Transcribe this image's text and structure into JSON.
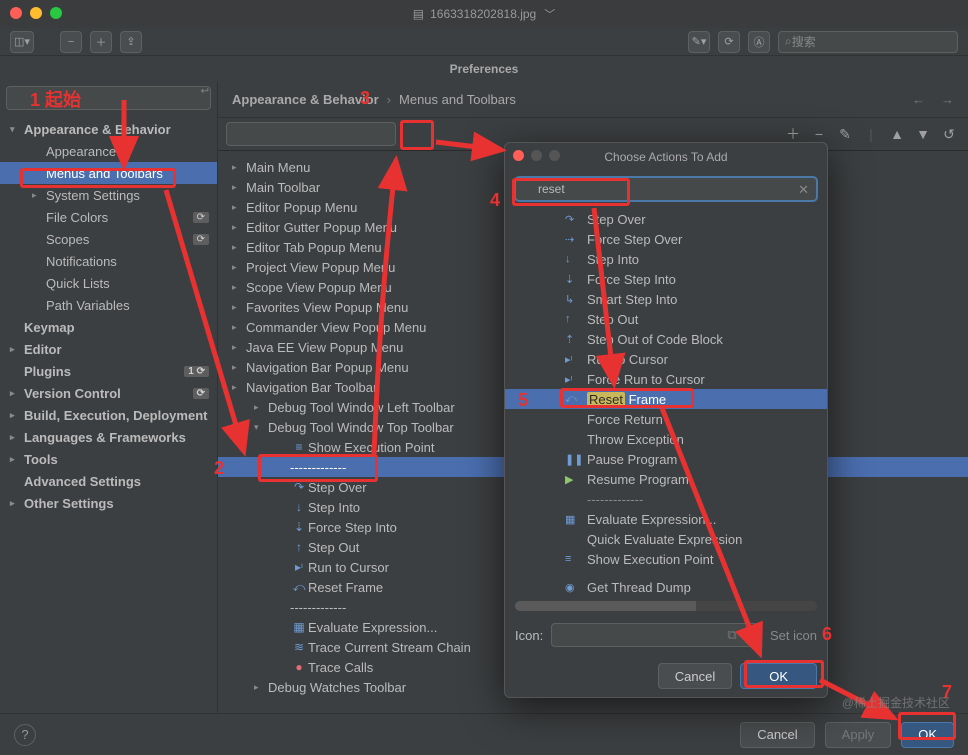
{
  "titlebar": {
    "filename": "1663318202818.jpg"
  },
  "maintool": {
    "search": "搜索"
  },
  "prefs_title": "Preferences",
  "breadcrumb": {
    "a": "Appearance & Behavior",
    "b": "Menus and Toolbars"
  },
  "sidebar": {
    "items": [
      {
        "label": "Appearance & Behavior",
        "caret": "▾",
        "bold": true,
        "lvl": 0
      },
      {
        "label": "Appearance",
        "lvl": 1
      },
      {
        "label": "Menus and Toolbars",
        "lvl": 1,
        "sel": true
      },
      {
        "label": "System Settings",
        "lvl": 1,
        "caret": "▸"
      },
      {
        "label": "File Colors",
        "lvl": 1,
        "badge": "⟳"
      },
      {
        "label": "Scopes",
        "lvl": 1,
        "badge": "⟳"
      },
      {
        "label": "Notifications",
        "lvl": 1
      },
      {
        "label": "Quick Lists",
        "lvl": 1
      },
      {
        "label": "Path Variables",
        "lvl": 1
      },
      {
        "label": "Keymap",
        "caret": "",
        "bold": true,
        "lvl": 0
      },
      {
        "label": "Editor",
        "caret": "▸",
        "bold": true,
        "lvl": 0
      },
      {
        "label": "Plugins",
        "caret": "",
        "bold": true,
        "lvl": 0,
        "badge": "1 ⟳"
      },
      {
        "label": "Version Control",
        "caret": "▸",
        "bold": true,
        "lvl": 0,
        "badge": "⟳"
      },
      {
        "label": "Build, Execution, Deployment",
        "caret": "▸",
        "bold": true,
        "lvl": 0
      },
      {
        "label": "Languages & Frameworks",
        "caret": "▸",
        "bold": true,
        "lvl": 0
      },
      {
        "label": "Tools",
        "caret": "▸",
        "bold": true,
        "lvl": 0
      },
      {
        "label": "Advanced Settings",
        "bold": true,
        "lvl": 0
      },
      {
        "label": "Other Settings",
        "caret": "▸",
        "bold": true,
        "lvl": 0
      }
    ]
  },
  "menulist": [
    {
      "c": "▸",
      "t": "Main Menu"
    },
    {
      "c": "▸",
      "t": "Main Toolbar"
    },
    {
      "c": "▸",
      "t": "Editor Popup Menu"
    },
    {
      "c": "▸",
      "t": "Editor Gutter Popup Menu"
    },
    {
      "c": "▸",
      "t": "Editor Tab Popup Menu"
    },
    {
      "c": "▸",
      "t": "Project View Popup Menu"
    },
    {
      "c": "▸",
      "t": "Scope View Popup Menu"
    },
    {
      "c": "▸",
      "t": "Favorites View Popup Menu"
    },
    {
      "c": "▸",
      "t": "Commander View Popup Menu"
    },
    {
      "c": "▸",
      "t": "Java EE View Popup Menu"
    },
    {
      "c": "▸",
      "t": "Navigation Bar Popup Menu"
    },
    {
      "c": "▸",
      "t": "Navigation Bar Toolbar"
    },
    {
      "c": "▸",
      "t": "Debug Tool Window Left Toolbar",
      "lvl": 0
    },
    {
      "c": "▾",
      "t": "Debug Tool Window Top Toolbar",
      "lvl": 0
    },
    {
      "ic": "≡",
      "t": "Show Execution Point",
      "lvl": 1
    },
    {
      "sep": true,
      "t": "-------------",
      "lvl": 1,
      "sel": true
    },
    {
      "ic": "↷",
      "t": "Step Over",
      "lvl": 1
    },
    {
      "ic": "↓",
      "t": "Step Into",
      "lvl": 1
    },
    {
      "ic": "⇣",
      "t": "Force Step Into",
      "lvl": 1
    },
    {
      "ic": "↑",
      "t": "Step Out",
      "lvl": 1
    },
    {
      "ic": "▸ᶦ",
      "t": "Run to Cursor",
      "lvl": 1
    },
    {
      "ic": "⤺",
      "t": "Reset Frame",
      "lvl": 1
    },
    {
      "sep": true,
      "t": "-------------",
      "lvl": 1
    },
    {
      "ic": "▦",
      "t": "Evaluate Expression...",
      "lvl": 1
    },
    {
      "ic": "≋",
      "t": "Trace Current Stream Chain",
      "lvl": 1
    },
    {
      "ic": "●",
      "t": "Trace Calls",
      "lvl": 1,
      "red": true
    },
    {
      "c": "▸",
      "t": "Debug Watches Toolbar",
      "lvl": 0
    }
  ],
  "modal": {
    "title": "Choose Actions To Add",
    "search": "reset",
    "actions": [
      {
        "ic": "↷",
        "t": "Step Over"
      },
      {
        "ic": "⇢",
        "t": "Force Step Over"
      },
      {
        "ic": "↓",
        "t": "Step Into"
      },
      {
        "ic": "⇣",
        "t": "Force Step Into"
      },
      {
        "ic": "↳",
        "t": "Smart Step Into"
      },
      {
        "ic": "↑",
        "t": "Step Out"
      },
      {
        "ic": "⇡",
        "t": "Step Out of Code Block"
      },
      {
        "ic": "▸ᶦ",
        "t": "Run to Cursor"
      },
      {
        "ic": "▸ᶦ",
        "t": "Force Run to Cursor"
      },
      {
        "ic": "⤺",
        "pre": "",
        "hl": "Reset",
        "post": " Frame",
        "sel": true
      },
      {
        "t": "Force Return"
      },
      {
        "t": "Throw Exception"
      },
      {
        "ic": "❚❚",
        "t": "Pause Program"
      },
      {
        "ic": "▶",
        "t": "Resume Program",
        "green": true
      },
      {
        "sep": true,
        "t": "-------------"
      },
      {
        "ic": "▦",
        "t": "Evaluate Expression..."
      },
      {
        "t": "Quick Evaluate Expression"
      },
      {
        "ic": "≡",
        "t": "Show Execution Point"
      },
      {
        "sep2": true
      },
      {
        "ic": "◉",
        "t": "Get Thread Dump"
      }
    ],
    "icon_label": "Icon:",
    "set_icon": "Set icon",
    "cancel": "Cancel",
    "ok": "OK"
  },
  "footer": {
    "cancel": "Cancel",
    "apply": "Apply",
    "ok": "OK"
  },
  "annotations": {
    "l1": "1 起始",
    "l2": "2",
    "l3": "3",
    "l4": "4",
    "l5": "5",
    "l6": "6",
    "l7": "7"
  },
  "watermark": "@稀土掘金技术社区"
}
